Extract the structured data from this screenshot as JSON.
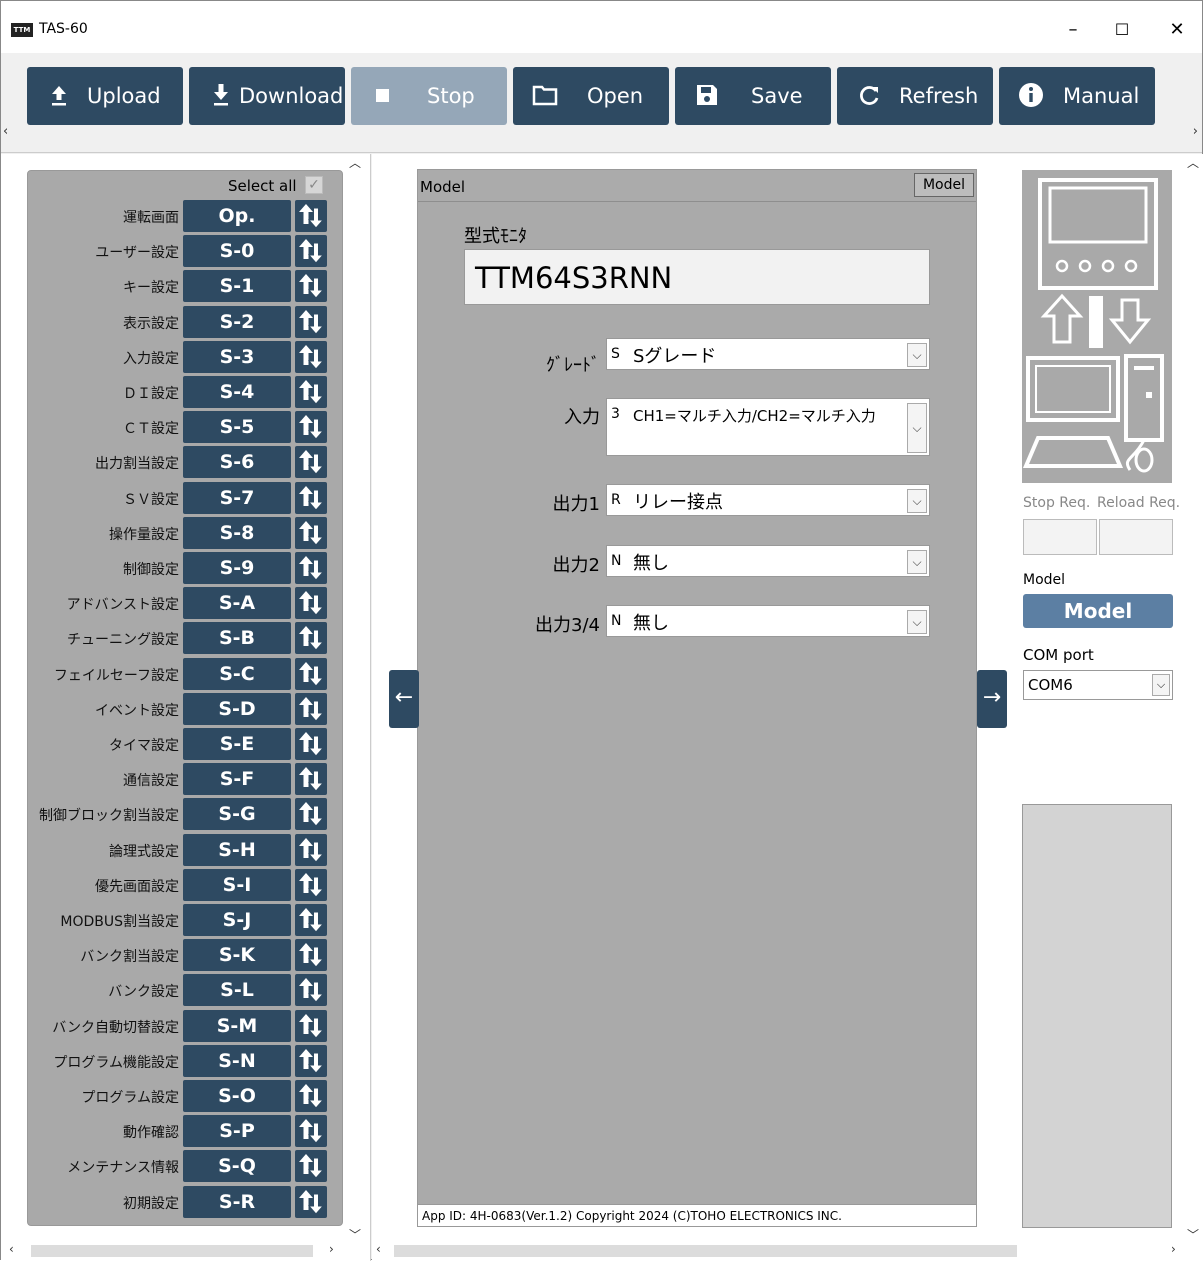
{
  "window": {
    "title": "TAS-60",
    "icon_text": "TTM"
  },
  "toolbar": {
    "buttons": [
      {
        "label": "Upload",
        "icon": "upload-icon",
        "enabled": true
      },
      {
        "label": "Download",
        "icon": "download-icon",
        "enabled": true
      },
      {
        "label": "Stop",
        "icon": "stop-icon",
        "enabled": false
      },
      {
        "label": "Open",
        "icon": "folder-icon",
        "enabled": true
      },
      {
        "label": "Save",
        "icon": "save-icon",
        "enabled": true
      },
      {
        "label": "Refresh",
        "icon": "refresh-icon",
        "enabled": true
      },
      {
        "label": "Manual",
        "icon": "info-icon",
        "enabled": true
      }
    ]
  },
  "settings_list": {
    "select_all": "Select all",
    "items": [
      {
        "name": "運転画面",
        "code": "Op."
      },
      {
        "name": "ユーザー設定",
        "code": "S-0"
      },
      {
        "name": "キー設定",
        "code": "S-1"
      },
      {
        "name": "表示設定",
        "code": "S-2"
      },
      {
        "name": "入力設定",
        "code": "S-3"
      },
      {
        "name": "ＤＩ設定",
        "code": "S-4"
      },
      {
        "name": "ＣＴ設定",
        "code": "S-5"
      },
      {
        "name": "出力割当設定",
        "code": "S-6"
      },
      {
        "name": "ＳＶ設定",
        "code": "S-7"
      },
      {
        "name": "操作量設定",
        "code": "S-8"
      },
      {
        "name": "制御設定",
        "code": "S-9"
      },
      {
        "name": "アドバンスト設定",
        "code": "S-A"
      },
      {
        "name": "チューニング設定",
        "code": "S-B"
      },
      {
        "name": "フェイルセーフ設定",
        "code": "S-C"
      },
      {
        "name": "イベント設定",
        "code": "S-D"
      },
      {
        "name": "タイマ設定",
        "code": "S-E"
      },
      {
        "name": "通信設定",
        "code": "S-F"
      },
      {
        "name": "制御ブロック割当設定",
        "code": "S-G"
      },
      {
        "name": "論理式設定",
        "code": "S-H"
      },
      {
        "name": "優先画面設定",
        "code": "S-I"
      },
      {
        "name": "MODBUS割当設定",
        "code": "S-J"
      },
      {
        "name": "バンク割当設定",
        "code": "S-K"
      },
      {
        "name": "バンク設定",
        "code": "S-L"
      },
      {
        "name": "バンク自動切替設定",
        "code": "S-M"
      },
      {
        "name": "プログラム機能設定",
        "code": "S-N"
      },
      {
        "name": "プログラム設定",
        "code": "S-O"
      },
      {
        "name": "動作確認",
        "code": "S-P"
      },
      {
        "name": "メンテナンス情報",
        "code": "S-Q"
      },
      {
        "name": "初期設定",
        "code": "S-R"
      }
    ]
  },
  "main": {
    "panel_title": "Model",
    "panel_tag": "Model",
    "monitor_label": "型式ﾓﾆﾀ",
    "monitor_value": "TTM64S3RNN",
    "fields": [
      {
        "label": "ｸﾞﾚｰﾄﾞ",
        "code": "S",
        "value": "Sグレード"
      },
      {
        "label": "入力",
        "code": "3",
        "value": "CH1=マルチ入力/CH2=マルチ入力"
      },
      {
        "label": "出力1",
        "code": "R",
        "value": "リレー接点"
      },
      {
        "label": "出力2",
        "code": "N",
        "value": "無し"
      },
      {
        "label": "出力3/4",
        "code": "N",
        "value": "無し"
      }
    ],
    "copyright": "App ID: 4H-0683(Ver.1.2) Copyright 2024 (C)TOHO ELECTRONICS INC."
  },
  "right": {
    "stop_req": "Stop Req.",
    "reload_req": "Reload Req.",
    "model_label": "Model",
    "model_button": "Model",
    "com_label": "COM port",
    "com_value": "COM6"
  },
  "colors": {
    "accent": "#2e4a62",
    "accent_disabled": "#95a7b8",
    "model_button": "#5c7fa3",
    "panel": "#a9a9a9"
  }
}
